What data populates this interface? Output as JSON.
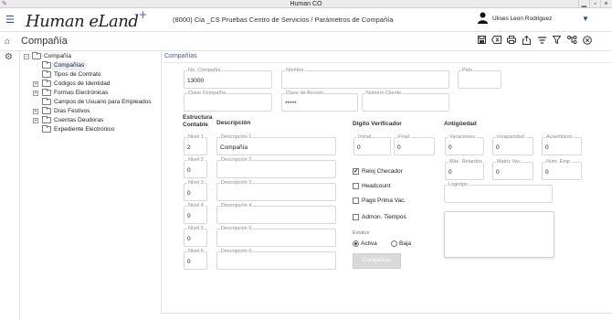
{
  "window": {
    "title": "Human CO",
    "min": "▁",
    "max": "▫",
    "close": "×"
  },
  "topbar": {
    "logo_text": "Human eLand",
    "logo_plus": "+",
    "breadcrumb": "(8000) Cia _CS  Pruebas Centro de Servicios /  Parámetros de Compañía",
    "user_name": "Ulises Leon Rodriguez"
  },
  "page": {
    "title": "Compañía"
  },
  "tree": {
    "root": "Compañía",
    "items": [
      {
        "label": "Compañías",
        "expandable": false,
        "selected": true
      },
      {
        "label": "Tipos de Contrato",
        "expandable": false
      },
      {
        "label": "Códigos de Identidad",
        "expandable": true
      },
      {
        "label": "Formas Electrónicas",
        "expandable": true
      },
      {
        "label": "Campos de Usuario para Empleados",
        "expandable": false
      },
      {
        "label": "Días Festivos",
        "expandable": true
      },
      {
        "label": "Cuentas Deudoras",
        "expandable": true
      },
      {
        "label": "Expediente Electrónico",
        "expandable": false
      }
    ]
  },
  "form": {
    "section_title": "Compañías",
    "no_compania": {
      "label": "No. Compañía",
      "value": "13000"
    },
    "nombre": {
      "label": "Nombre",
      "value": ""
    },
    "pais": {
      "label": "País",
      "value": ""
    },
    "clave_compania": {
      "label": "Clave Compañía",
      "value": ""
    },
    "clave_acceso": {
      "label": "Clave de Acceso",
      "value": "*****"
    },
    "numero_cliente": {
      "label": "Número Cliente",
      "value": ""
    },
    "estructura_contable": "Estructura Contable",
    "descripcion_header": "Descripción",
    "niveles": [
      {
        "label": "Nivel 1",
        "value": "2",
        "desc_label": "Descripción 1",
        "desc_value": "Compañía"
      },
      {
        "label": "Nivel 2",
        "value": "0",
        "desc_label": "Descripción 2",
        "desc_value": ""
      },
      {
        "label": "Nivel 3",
        "value": "0",
        "desc_label": "Descripción 3",
        "desc_value": ""
      },
      {
        "label": "Nivel 4",
        "value": "0",
        "desc_label": "Descripción 4",
        "desc_value": ""
      },
      {
        "label": "Nivel 5",
        "value": "0",
        "desc_label": "Descripción 5",
        "desc_value": ""
      },
      {
        "label": "Nivel 6",
        "value": "0",
        "desc_label": "Descripción 6",
        "desc_value": ""
      }
    ],
    "digito_verificador": {
      "title": "Dígito Verificador",
      "inicial": {
        "label": "Inicial",
        "value": "0"
      },
      "final": {
        "label": "Final",
        "value": "0"
      }
    },
    "checkboxes": [
      {
        "label": "Reloj Checador",
        "checked": true,
        "mark": "✔"
      },
      {
        "label": "Headcount",
        "checked": false,
        "mark": ""
      },
      {
        "label": "Pago Prima Vac.",
        "checked": false,
        "mark": ""
      },
      {
        "label": "Admon. Tiempos",
        "checked": false,
        "mark": ""
      }
    ],
    "estatus": {
      "label": "Estatus",
      "activa": "Activa",
      "baja": "Baja",
      "selected": "Activa"
    },
    "button_label": "Compañías",
    "antiguedad": {
      "title": "Antigüedad",
      "vacaciones": {
        "label": "Vacaciones",
        "value": "0"
      },
      "incapacidad": {
        "label": "Incapacidad",
        "value": "0"
      },
      "ausentismo": {
        "label": "Ausentismo",
        "value": "0"
      },
      "max_retardos": {
        "label": "Máx. Retardos",
        "value": "0"
      },
      "matriz_vac": {
        "label": "Matriz Vac.",
        "value": "0"
      },
      "num_emp": {
        "label": "Núm. Emp.",
        "value": "0"
      }
    },
    "logotipo": {
      "label": "Logotipo",
      "value": ""
    }
  },
  "colors": {
    "accent": "#3a5aa8",
    "brand_plus": "#6a4ea8"
  },
  "icons": [
    "menu-icon",
    "home-icon",
    "settings-icon",
    "user-icon",
    "save-icon",
    "clear-icon",
    "print-icon",
    "export-icon",
    "sort-icon",
    "filter-icon",
    "hierarchy-icon",
    "close-circle-icon"
  ]
}
